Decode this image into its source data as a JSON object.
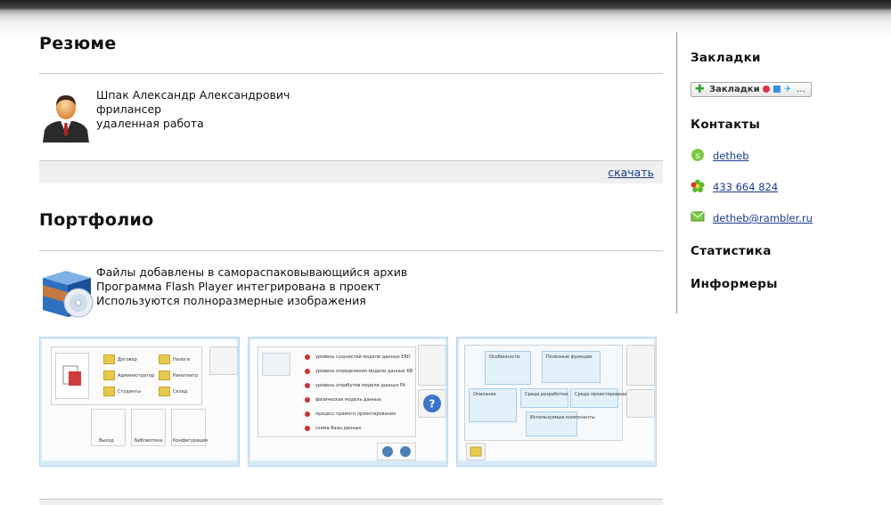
{
  "resume": {
    "title": "Резюме",
    "name": "Шпак Александр Александрович",
    "role": "фрилансер",
    "work_type": "удаленная работа",
    "download_label": "скачать"
  },
  "portfolio": {
    "title": "Портфолио",
    "lines": [
      "Файлы добавлены в самораспаковывающийся архив",
      "Программа Flash Player интегрирована в проект",
      "Используются полноразмерные изображения"
    ],
    "thumb1": {
      "folders": [
        "Договор",
        "Администратор",
        "Студенты",
        "Налоги",
        "Кинотеатр",
        "Склад"
      ],
      "buttons": [
        "Выход",
        "Библиотека",
        "Конфигурация"
      ]
    },
    "thumb2": {
      "items": [
        "уровень сущностей модели данных ERD",
        "уровень определения модели данных KB",
        "уровень атрибутов модели данных FA",
        "физическая модель данных",
        "процесс прямого проектирования",
        "схема базы данных"
      ]
    },
    "thumb3": {
      "notes": [
        "Особенности",
        "Полезные функции",
        "Описание",
        "Среда разработки",
        "Среда проектирования",
        "Используемые компоненты"
      ]
    }
  },
  "sidebar": {
    "bookmarks_title": "Закладки",
    "bookmarks_button": "Закладки",
    "contacts_title": "Контакты",
    "contacts": [
      {
        "icon": "skype-icon",
        "text": "detheb"
      },
      {
        "icon": "icq-flower-icon",
        "text": "433 664 824"
      },
      {
        "icon": "email-envelope-icon",
        "text": "detheb@rambler.ru"
      }
    ],
    "stats_title": "Статистика",
    "informers_title": "Информеры"
  },
  "colors": {
    "link": "#1a3c8c",
    "thumb_frame": "#d8eaf6",
    "divider": "#c4c4c4"
  }
}
